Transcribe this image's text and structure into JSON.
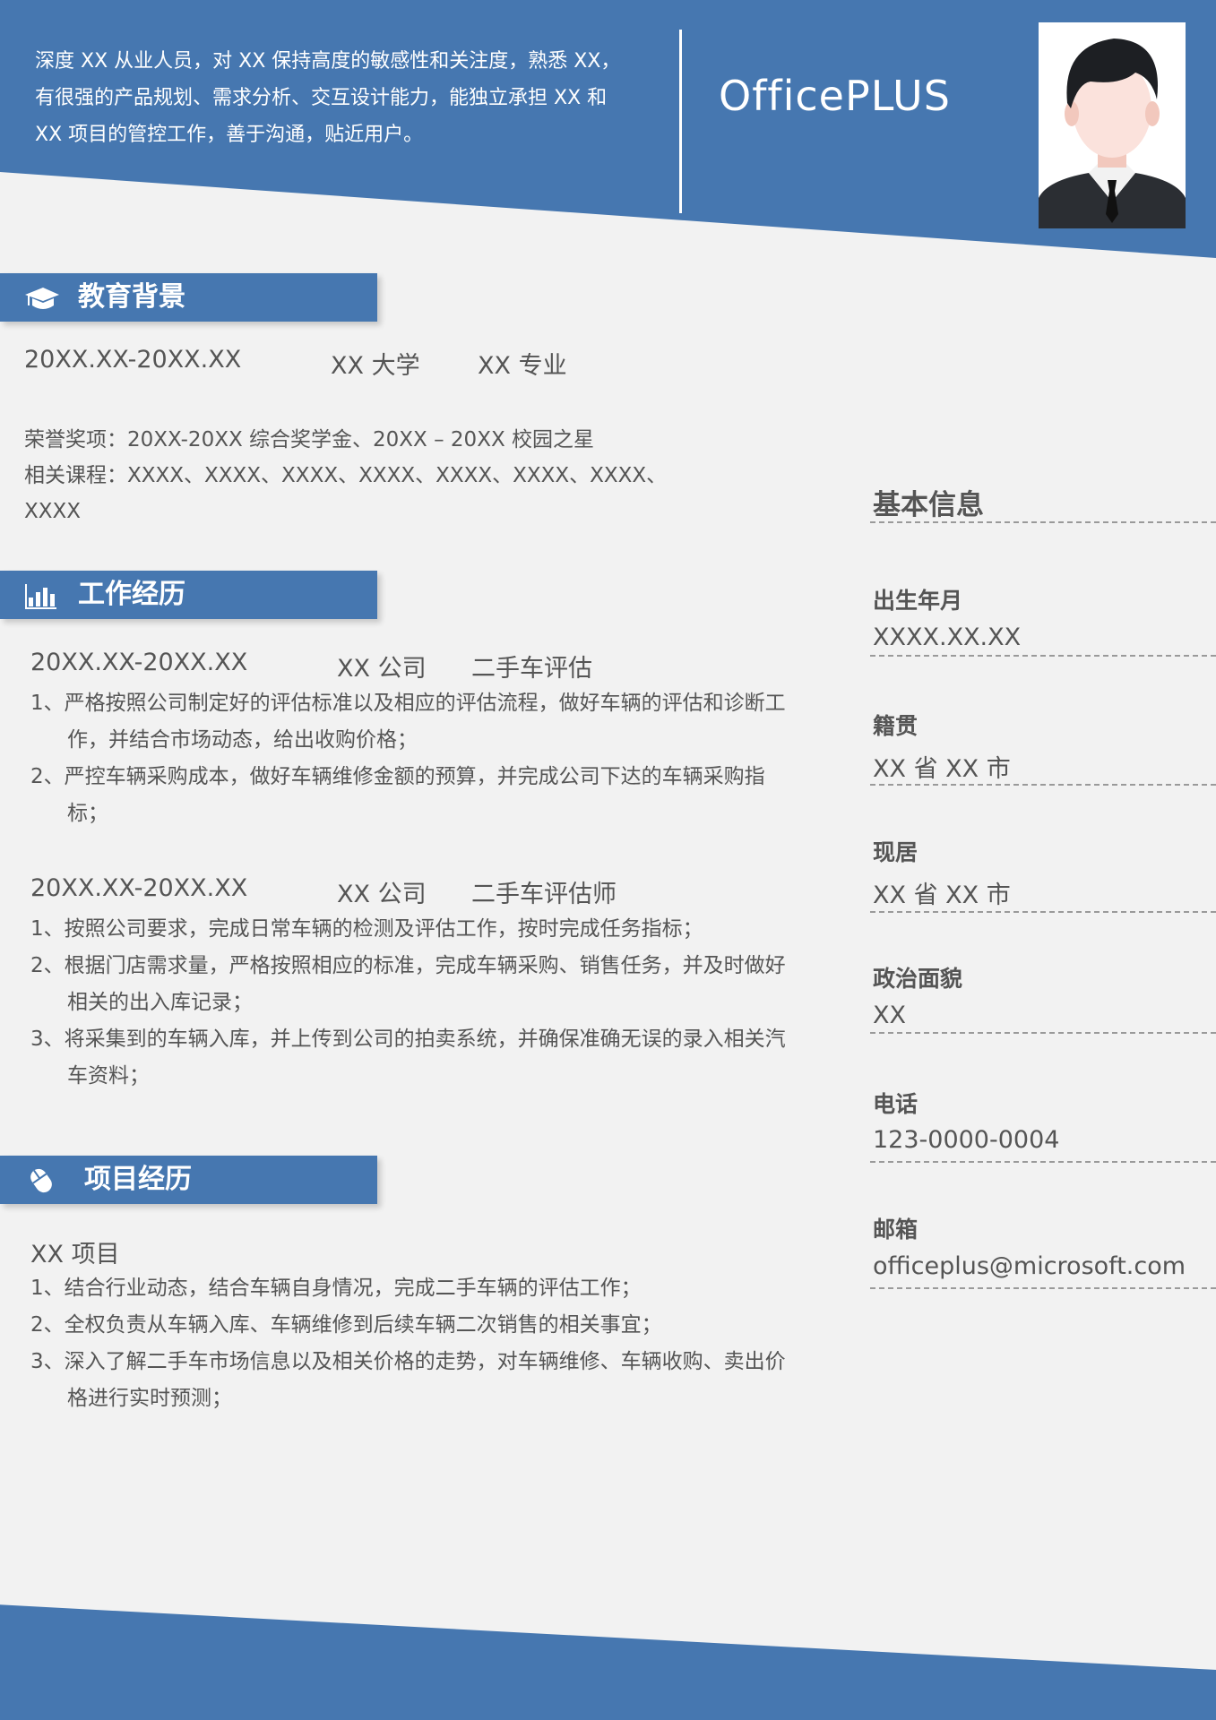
{
  "header": {
    "summary_lines": [
      "深度 XX 从业人员，对 XX 保持高度的敏感性和关注度，熟悉 XX，",
      "有很强的产品规划、需求分析、交互设计能力，能独立承担 XX 和",
      "XX 项目的管控工作，善于沟通，贴近用户。"
    ],
    "brand": "OfficePLUS"
  },
  "education": {
    "title": "教育背景",
    "period": "20XX.XX-20XX.XX",
    "school": "XX 大学",
    "major": "XX 专业",
    "honors": "荣誉奖项：20XX-20XX  综合奖学金、20XX  –  20XX 校园之星",
    "courses_line1": "相关课程：XXXX、XXXX、XXXX、XXXX、XXXX、XXXX、XXXX、",
    "courses_line2": "XXXX"
  },
  "work": {
    "title": "工作经历",
    "jobs": [
      {
        "period": "20XX.XX-20XX.XX",
        "company": "XX 公司",
        "role": "二手车评估",
        "items": [
          "1、严格按照公司制定好的评估标准以及相应的评估流程，做好车辆的评估和诊断工作，并结合市场动态，给出收购价格；",
          "2、严控车辆采购成本，做好车辆维修金额的预算，并完成公司下达的车辆采购指标；"
        ]
      },
      {
        "period": "20XX.XX-20XX.XX",
        "company": "XX 公司",
        "role": "二手车评估师",
        "items": [
          "1、按照公司要求，完成日常车辆的检测及评估工作，按时完成任务指标；",
          "2、根据门店需求量，严格按照相应的标准，完成车辆采购、销售任务，并及时做好相关的出入库记录；",
          "3、将采集到的车辆入库，并上传到公司的拍卖系统，并确保准确无误的录入相关汽车资料；"
        ]
      }
    ]
  },
  "projects": {
    "title": "项目经历",
    "name": "XX 项目",
    "items": [
      "1、结合行业动态，结合车辆自身情况，完成二手车辆的评估工作；",
      "2、全权负责从车辆入库、车辆维修到后续车辆二次销售的相关事宜；",
      "3、深入了解二手车市场信息以及相关价格的走势，对车辆维修、车辆收购、卖出价格进行实时预测；"
    ]
  },
  "basic_info": {
    "title": "基本信息",
    "fields": [
      {
        "label": "出生年月",
        "value": "XXXX.XX.XX"
      },
      {
        "label": "籍贯",
        "value": "XX 省 XX 市"
      },
      {
        "label": "现居",
        "value": "XX 省 XX 市"
      },
      {
        "label": "政治面貌",
        "value": "XX"
      },
      {
        "label": "电话",
        "value": "123-0000-0004"
      },
      {
        "label": "邮箱",
        "value": "officeplus@microsoft.com"
      }
    ]
  },
  "colors": {
    "accent": "#4677b0",
    "background": "#f2f2f2",
    "text": "#555555"
  }
}
